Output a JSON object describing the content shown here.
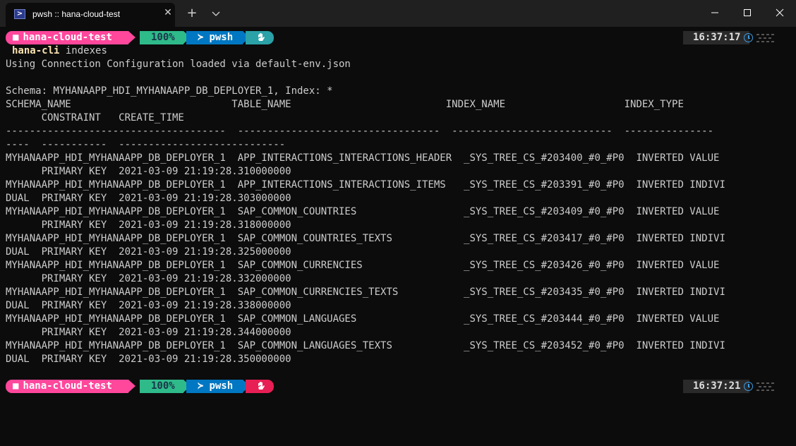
{
  "titlebar": {
    "tab_title": "pwsh :: hana-cloud-test",
    "close_tab": "✕",
    "new_tab": "+"
  },
  "prompt": {
    "path": "hana-cloud-test",
    "battery": "100%",
    "shell": "pwsh",
    "shell_chevron": "≻",
    "time_1": "16:37:17",
    "time_2": "16:37:21",
    "status_color_1": "#2aa2a8",
    "status_color_2": "#e81f54"
  },
  "command": {
    "name": "hana-cli",
    "arg": " indexes"
  },
  "output": [
    "Using Connection Configuration loaded via default-env.json",
    "",
    "Schema: MYHANAAPP_HDI_MYHANAAPP_DB_DEPLOYER_1, Index: *",
    "SCHEMA_NAME                           TABLE_NAME                          INDEX_NAME                    INDEX_TYPE",
    "      CONSTRAINT   CREATE_TIME",
    "-------------------------------------  ----------------------------------  ---------------------------  ---------------",
    "----  -----------  ----------------------------",
    "MYHANAAPP_HDI_MYHANAAPP_DB_DEPLOYER_1  APP_INTERACTIONS_INTERACTIONS_HEADER  _SYS_TREE_CS_#203400_#0_#P0  INVERTED VALUE",
    "      PRIMARY KEY  2021-03-09 21:19:28.310000000",
    "MYHANAAPP_HDI_MYHANAAPP_DB_DEPLOYER_1  APP_INTERACTIONS_INTERACTIONS_ITEMS   _SYS_TREE_CS_#203391_#0_#P0  INVERTED INDIVI",
    "DUAL  PRIMARY KEY  2021-03-09 21:19:28.303000000",
    "MYHANAAPP_HDI_MYHANAAPP_DB_DEPLOYER_1  SAP_COMMON_COUNTRIES                  _SYS_TREE_CS_#203409_#0_#P0  INVERTED VALUE",
    "      PRIMARY KEY  2021-03-09 21:19:28.318000000",
    "MYHANAAPP_HDI_MYHANAAPP_DB_DEPLOYER_1  SAP_COMMON_COUNTRIES_TEXTS            _SYS_TREE_CS_#203417_#0_#P0  INVERTED INDIVI",
    "DUAL  PRIMARY KEY  2021-03-09 21:19:28.325000000",
    "MYHANAAPP_HDI_MYHANAAPP_DB_DEPLOYER_1  SAP_COMMON_CURRENCIES                 _SYS_TREE_CS_#203426_#0_#P0  INVERTED VALUE",
    "      PRIMARY KEY  2021-03-09 21:19:28.332000000",
    "MYHANAAPP_HDI_MYHANAAPP_DB_DEPLOYER_1  SAP_COMMON_CURRENCIES_TEXTS           _SYS_TREE_CS_#203435_#0_#P0  INVERTED INDIVI",
    "DUAL  PRIMARY KEY  2021-03-09 21:19:28.338000000",
    "MYHANAAPP_HDI_MYHANAAPP_DB_DEPLOYER_1  SAP_COMMON_LANGUAGES                  _SYS_TREE_CS_#203444_#0_#P0  INVERTED VALUE",
    "      PRIMARY KEY  2021-03-09 21:19:28.344000000",
    "MYHANAAPP_HDI_MYHANAAPP_DB_DEPLOYER_1  SAP_COMMON_LANGUAGES_TEXTS            _SYS_TREE_CS_#203452_#0_#P0  INVERTED INDIVI",
    "DUAL  PRIMARY KEY  2021-03-09 21:19:28.350000000"
  ],
  "colors": {
    "background": "#0c0c0c",
    "foreground": "#cccccc",
    "path_segment": "#ff479c",
    "battery_segment": "#2fba8a",
    "shell_segment": "#0077c2"
  }
}
